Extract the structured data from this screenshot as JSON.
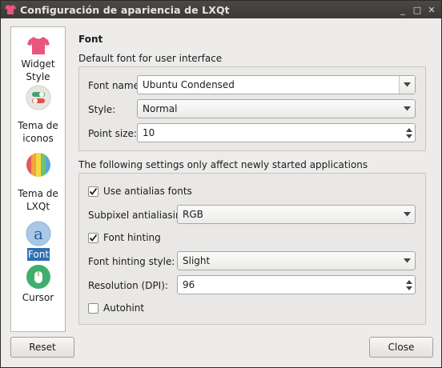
{
  "window": {
    "title": "Configuración de apariencia de LXQt",
    "minimize_glyph": "_",
    "maximize_glyph": "□",
    "close_glyph": "✕"
  },
  "sidebar": {
    "items": [
      {
        "label": "Widget Style",
        "icon": "tshirt-icon"
      },
      {
        "label": "Tema de iconos",
        "icon": "toggle-icon"
      },
      {
        "label": "Tema de LXQt",
        "icon": "rainbow-icon"
      },
      {
        "label": "Font",
        "icon": "font-a-icon",
        "selected": true
      },
      {
        "label": "Cursor",
        "icon": "mouse-icon"
      }
    ]
  },
  "page": {
    "heading": "Font",
    "default_font_group": {
      "title": "Default font for user interface",
      "font_name_label": "Font name:",
      "font_name_value": "Ubuntu Condensed",
      "style_label": "Style:",
      "style_value": "Normal",
      "point_size_label": "Point size:",
      "point_size_value": "10"
    },
    "new_apps_group": {
      "title": "The following settings only affect newly started applications",
      "antialias_label": "Use antialias fonts",
      "antialias_checked": true,
      "subpixel_label": "Subpixel antialiasing:",
      "subpixel_value": "RGB",
      "hinting_label": "Font hinting",
      "hinting_checked": true,
      "hinting_style_label": "Font hinting style:",
      "hinting_style_value": "Slight",
      "dpi_label": "Resolution (DPI):",
      "dpi_value": "96",
      "autohint_label": "Autohint",
      "autohint_checked": false
    }
  },
  "footer": {
    "reset_label": "Reset",
    "close_label": "Close"
  },
  "colors": {
    "titlebar": "#3a3935",
    "selection": "#2f6fb6",
    "window_bg": "#edeceb"
  }
}
